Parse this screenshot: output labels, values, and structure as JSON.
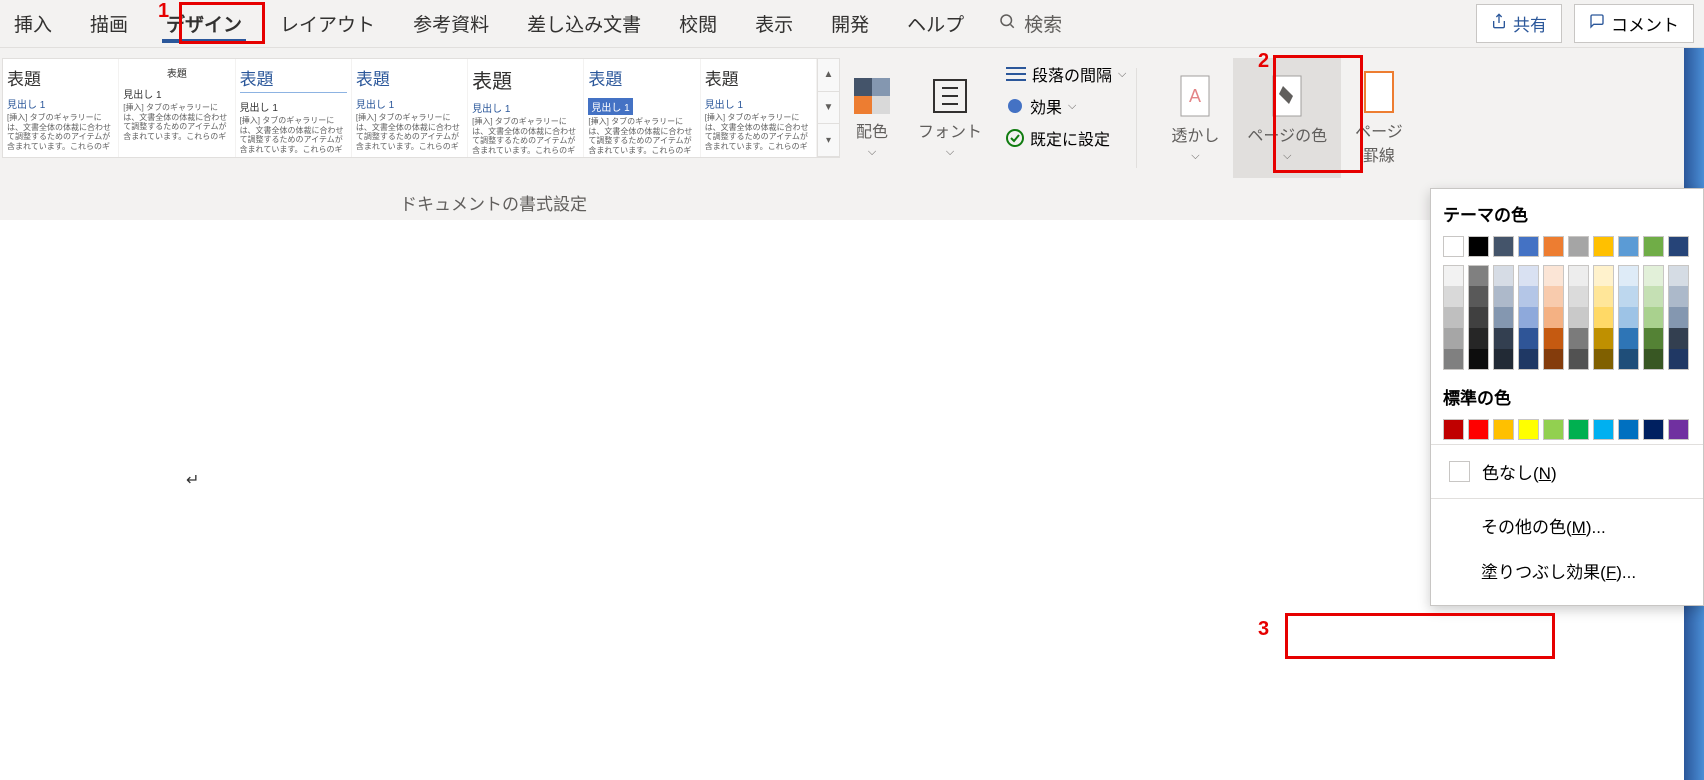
{
  "tabs": {
    "insert": "挿入",
    "draw": "描画",
    "design": "デザイン",
    "layout": "レイアウト",
    "references": "参考資料",
    "mailings": "差し込み文書",
    "review": "校閲",
    "view": "表示",
    "developer": "開発",
    "help": "ヘルプ",
    "search": "検索"
  },
  "buttons": {
    "share": "共有",
    "comment": "コメント"
  },
  "styles": {
    "title": "表題",
    "heading1": "見出し 1",
    "desc": "[挿入] タブのギャラリーには、文書全体の体裁に合わせて調整するためのアイテムが含まれています。これらのギ"
  },
  "ribbon": {
    "colors": "配色",
    "fonts": "フォント",
    "paragraph_spacing": "段落の間隔",
    "effects": "効果",
    "set_default": "既定に設定",
    "watermark": "透かし",
    "page_color": "ページの色",
    "page_borders_l1": "ページ",
    "page_borders_l2": "罫線",
    "doc_formatting": "ドキュメントの書式設定"
  },
  "dropdown": {
    "theme_colors": "テーマの色",
    "standard_colors": "標準の色",
    "no_color": "色なし(",
    "no_color_key": "N",
    "no_color_end": ")",
    "more_colors": "その他の色(",
    "more_colors_key": "M",
    "more_colors_end": ")...",
    "fill_effects": "塗りつぶし効果(",
    "fill_effects_key": "F",
    "fill_effects_end": ")...",
    "theme_row": [
      "#ffffff",
      "#000000",
      "#44546a",
      "#4472c4",
      "#ed7d31",
      "#a5a5a5",
      "#ffc000",
      "#5b9bd5",
      "#70ad47",
      "#264478"
    ],
    "shade_cols": [
      [
        "#f2f2f2",
        "#d9d9d9",
        "#bfbfbf",
        "#a6a6a6",
        "#808080"
      ],
      [
        "#808080",
        "#595959",
        "#404040",
        "#262626",
        "#0d0d0d"
      ],
      [
        "#d6dce5",
        "#adb9ca",
        "#8497b0",
        "#333f50",
        "#222a35"
      ],
      [
        "#d9e1f2",
        "#b4c6e7",
        "#8ea9db",
        "#2f5597",
        "#1f3864"
      ],
      [
        "#fbe5d6",
        "#f8cbad",
        "#f4b183",
        "#c55a11",
        "#843c0c"
      ],
      [
        "#ededed",
        "#dbdbdb",
        "#c9c9c9",
        "#7b7b7b",
        "#525252"
      ],
      [
        "#fff2cc",
        "#ffe699",
        "#ffd966",
        "#bf9000",
        "#806000"
      ],
      [
        "#deebf7",
        "#bdd7ee",
        "#9dc3e6",
        "#2e75b6",
        "#1f4e79"
      ],
      [
        "#e2f0d9",
        "#c5e0b4",
        "#a9d18e",
        "#548235",
        "#385723"
      ],
      [
        "#d5dce4",
        "#acb9ca",
        "#8497b0",
        "#333f50",
        "#203864"
      ]
    ],
    "standard_row": [
      "#c00000",
      "#ff0000",
      "#ffc000",
      "#ffff00",
      "#92d050",
      "#00b050",
      "#00b0f0",
      "#0070c0",
      "#002060",
      "#7030a0"
    ]
  },
  "annotations": {
    "n1": "1",
    "n2": "2",
    "n3": "3"
  },
  "cursor": "↵"
}
